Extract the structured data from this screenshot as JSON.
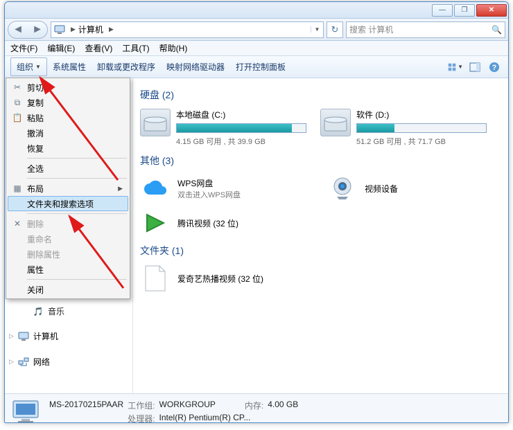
{
  "titlebar": {
    "min": "—",
    "max": "❐",
    "close": "✕"
  },
  "nav": {
    "address_seg": "计算机",
    "refresh": "↻",
    "search_placeholder": "搜索 计算机",
    "search_icon": "🔍"
  },
  "menubar": {
    "file": "文件(F)",
    "edit": "编辑(E)",
    "view": "查看(V)",
    "tools": "工具(T)",
    "help": "帮助(H)"
  },
  "toolbar": {
    "organize": "组织",
    "sys_props": "系统属性",
    "uninstall": "卸载或更改程序",
    "map_drive": "映射网络驱动器",
    "control_panel": "打开控制面板"
  },
  "dropdown": {
    "cut": "剪切",
    "copy": "复制",
    "paste": "粘贴",
    "undo": "撤消",
    "redo": "恢复",
    "select_all": "全选",
    "layout": "布局",
    "folder_search_options": "文件夹和搜索选项",
    "delete": "删除",
    "rename": "重命名",
    "remove_props": "删除属性",
    "properties": "属性",
    "close": "关闭"
  },
  "sidebar": {
    "music": "音乐",
    "computer": "计算机",
    "network": "网络"
  },
  "content": {
    "section_hdd": "硬盘 (2)",
    "drive_c": {
      "name": "本地磁盘 (C:)",
      "meta": "4.15 GB 可用 , 共 39.9 GB",
      "fill": 89
    },
    "drive_d": {
      "name": "软件 (D:)",
      "meta": "51.2 GB 可用 , 共 71.7 GB",
      "fill": 29
    },
    "section_other": "其他 (3)",
    "wps": {
      "name": "WPS网盘",
      "sub": "双击进入WPS网盘"
    },
    "video_device": "视频设备",
    "tencent": "腾讯视频 (32 位)",
    "section_folder": "文件夹 (1)",
    "iqiyi": "爱奇艺热播视频 (32 位)"
  },
  "details": {
    "name": "MS-20170215PAAR",
    "workgroup_label": "工作组:",
    "workgroup": "WORKGROUP",
    "cpu_label": "处理器:",
    "cpu": "Intel(R) Pentium(R) CP...",
    "mem_label": "内存:",
    "mem": "4.00 GB"
  }
}
